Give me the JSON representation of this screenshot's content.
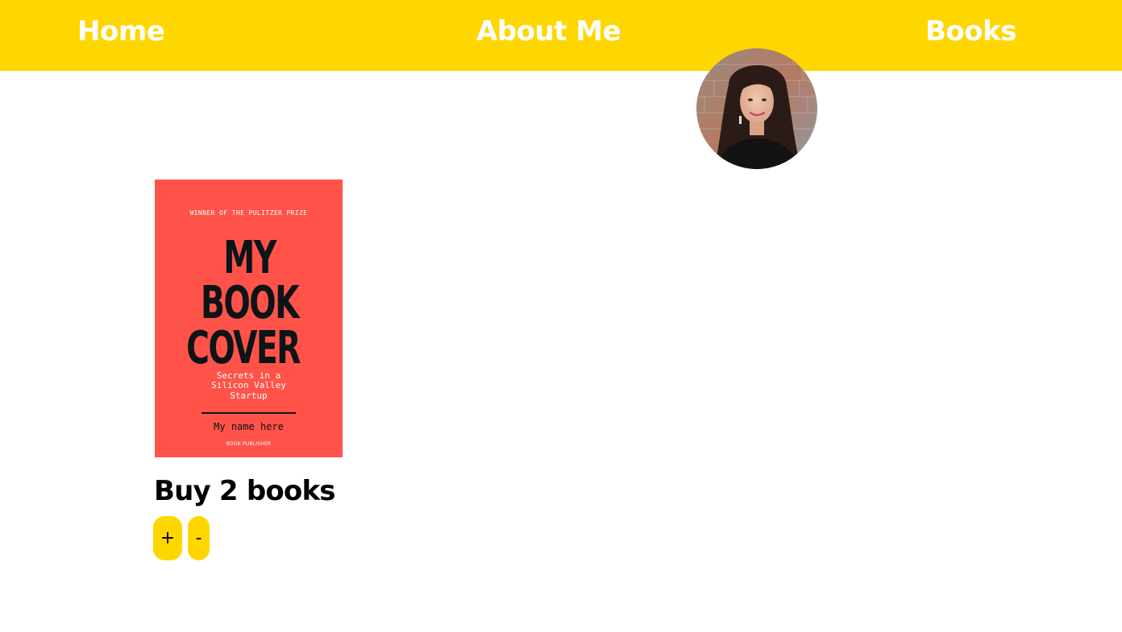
{
  "nav": {
    "home": "Home",
    "about": "About Me",
    "books": "Books"
  },
  "colors": {
    "nav_background": "#FFD700",
    "button_background": "#FFD700",
    "cover_background": "#FF5349"
  },
  "profile": {
    "avatar_icon": "profile-photo"
  },
  "book_cover": {
    "award": "WINNER OF THE PULITZER PRIZE",
    "title_lines": [
      "MY",
      "BOOK",
      "COVER"
    ],
    "subtitle_lines": [
      "Secrets in a",
      "Silicon Valley",
      "Startup"
    ],
    "author": "My name here",
    "publisher": "BOOK PUBLISHER"
  },
  "purchase": {
    "heading": "Buy 2 books",
    "plus_label": "+",
    "minus_label": "-"
  }
}
